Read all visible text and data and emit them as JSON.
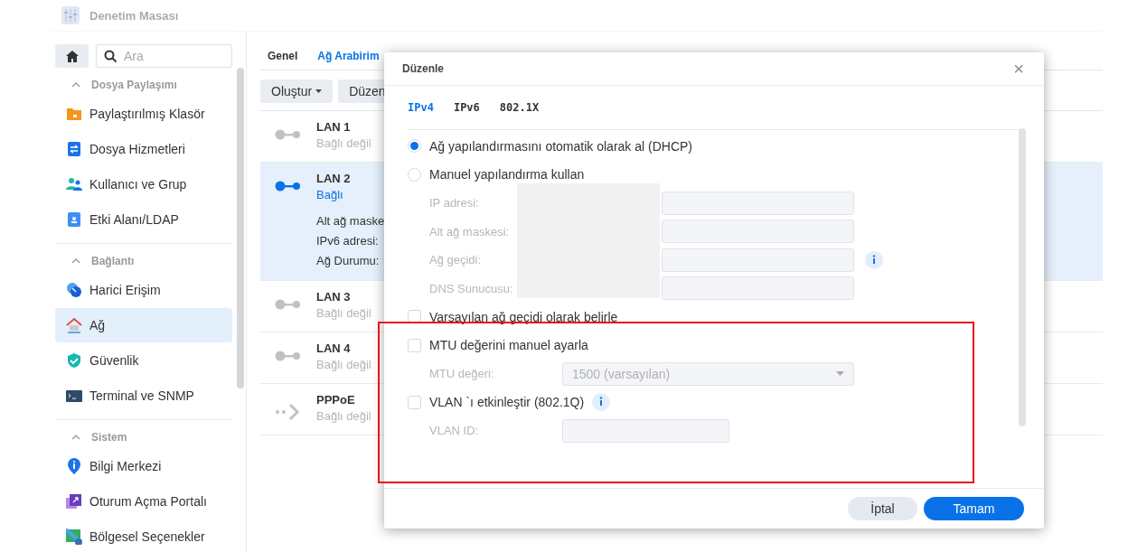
{
  "app": {
    "title": "Denetim Masası"
  },
  "sidebar": {
    "search": {
      "placeholder": "Ara"
    },
    "groups": [
      {
        "title": "Dosya Paylaşımı",
        "expanded": true,
        "items": [
          {
            "label": "Paylaştırılmış Klasör",
            "kind": "folder",
            "selected": false
          },
          {
            "label": "Dosya Hizmetleri",
            "kind": "transfer",
            "selected": false
          },
          {
            "label": "Kullanıcı ve Grup",
            "kind": "users",
            "selected": false
          },
          {
            "label": "Etki Alanı/LDAP",
            "kind": "badge",
            "selected": false
          }
        ]
      },
      {
        "title": "Bağlantı",
        "expanded": true,
        "items": [
          {
            "label": "Harici Erişim",
            "kind": "globe",
            "selected": false
          },
          {
            "label": "Ağ",
            "kind": "house",
            "selected": true
          },
          {
            "label": "Güvenlik",
            "kind": "shield",
            "selected": false
          },
          {
            "label": "Terminal ve SNMP",
            "kind": "terminal",
            "selected": false
          }
        ]
      },
      {
        "title": "Sistem",
        "expanded": true,
        "items": [
          {
            "label": "Bilgi Merkezi",
            "kind": "info",
            "selected": false
          },
          {
            "label": "Oturum Açma Portalı",
            "kind": "portal",
            "selected": false
          },
          {
            "label": "Bölgesel Seçenekler",
            "kind": "region",
            "selected": false
          }
        ]
      }
    ]
  },
  "content": {
    "tabs": [
      {
        "label": "Genel",
        "selected": false
      },
      {
        "label": "Ağ Arabirim",
        "selected": true
      }
    ],
    "toolbar": [
      {
        "label": "Oluştur",
        "kind": "dropdown"
      },
      {
        "label": "Düzen",
        "kind": "plain"
      }
    ],
    "interfaces": [
      {
        "name": "LAN 1",
        "status": "Bağlı değil",
        "kind": "lan",
        "connected": false,
        "selected": false
      },
      {
        "name": "LAN 2",
        "status": "Bağlı",
        "kind": "lan",
        "connected": true,
        "selected": true,
        "details": [
          "Alt ağ maske",
          "IPv6 adresi:",
          "Ağ Durumu:"
        ]
      },
      {
        "name": "LAN 3",
        "status": "Bağlı değil",
        "kind": "lan",
        "connected": false,
        "selected": false
      },
      {
        "name": "LAN 4",
        "status": "Bağlı değil",
        "kind": "lan",
        "connected": false,
        "selected": false
      },
      {
        "name": "PPPoE",
        "status": "Bağlı değil",
        "kind": "pppoe",
        "connected": false,
        "selected": false
      }
    ]
  },
  "dialog": {
    "title": "Düzenle",
    "close": "×",
    "tabs": [
      {
        "label": "IPv4",
        "selected": true
      },
      {
        "label": "IPv6",
        "selected": false
      },
      {
        "label": "802.1X",
        "selected": false
      }
    ],
    "items": [
      {
        "kind": "radio",
        "label": "Ağ yapılandırmasını otomatik olarak al (DHCP)",
        "selected": true
      },
      {
        "kind": "radio",
        "label": "Manuel yapılandırma kullan",
        "selected": false
      },
      {
        "kind": "field",
        "label": "IP adresi:",
        "disabled": true,
        "redacted": true
      },
      {
        "kind": "field",
        "label": "Alt ağ maskesi:",
        "disabled": true,
        "redacted": true
      },
      {
        "kind": "field",
        "label": "Ağ geçidi:",
        "disabled": true,
        "info": true,
        "redacted": true
      },
      {
        "kind": "field",
        "label": "DNS Sunucusu:",
        "disabled": true,
        "redacted": true
      },
      {
        "kind": "checkbox",
        "label": "Varsayılan ağ geçidi olarak belirle",
        "checked": false
      },
      {
        "kind": "checkbox",
        "label": "MTU değerini manuel ayarla",
        "checked": false,
        "highlighted": true
      },
      {
        "kind": "select",
        "label": "MTU değeri:",
        "value": "1500 (varsayılan)",
        "disabled": true
      },
      {
        "kind": "checkbox",
        "label": "VLAN `ı etkinleştir (802.1Q)",
        "checked": false,
        "info": true
      },
      {
        "kind": "field",
        "label": "VLAN ID:",
        "disabled": true,
        "short": true
      }
    ],
    "buttons": [
      {
        "label": "İptal",
        "kind": "secondary"
      },
      {
        "label": "Tamam",
        "kind": "primary"
      }
    ]
  }
}
